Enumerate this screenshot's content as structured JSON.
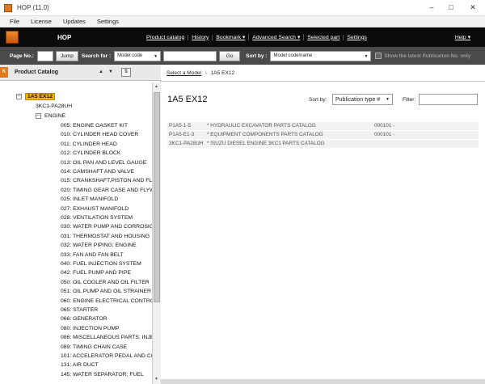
{
  "window": {
    "title": "HOP (11.0)"
  },
  "menubar": [
    "File",
    "License",
    "Updates",
    "Settings"
  ],
  "header": {
    "brand": "HOP",
    "links": [
      "Product catalog",
      "History",
      "Bookmark ▾",
      "Advanced Search ▾",
      "Selected part",
      "Settings"
    ],
    "help": "Help ▾"
  },
  "searchbar": {
    "page_label": "Page No.:",
    "page_value": "",
    "jump_label": "Jump",
    "search_for_label": "Search for :",
    "search_field_value": "Model code",
    "search_text_value": "",
    "go_label": "Go",
    "sort_by_label": "Sort by :",
    "sort_value": "Model code/name",
    "latest_label": "Show the latest Publication No. only"
  },
  "left_panel": {
    "title": "Product Catalog",
    "tab_letter": "K",
    "tree": {
      "root": "1A5 EX12",
      "child": "3KC1-PA28UH",
      "group": "ENGINE",
      "items": [
        "005: ENGINE GASKET KIT",
        "010: CYLINDER HEAD COVER",
        "011: CYLINDER HEAD",
        "012: CYLINDER BLOCK",
        "013: OIL PAN AND LEVEL GAUGE",
        "014: CAMSHAFT AND VALVE",
        "015: CRANKSHAFT,PISTON AND FLY",
        "020: TIMING GEAR CASE AND FLYW",
        "025: INLET MANIFOLD",
        "027: EXHAUST MANIFOLD",
        "028: VENTILATION SYSTEM",
        "030: WATER PUMP AND CORROSIC",
        "031: THERMOSTAT AND HOUSING",
        "032: WATER PIPING; ENGINE",
        "033: FAN AND FAN BELT",
        "040: FUEL INJECTION SYSTEM",
        "042: FUEL PUMP AND PIPE",
        "050: OIL COOLER AND OIL FILTER",
        "051: OIL PUMP AND OIL STRAINER",
        "060: ENGINE ELECTRICAL CONTRO",
        "065: STARTER",
        "066: GENERATOR",
        "080: INJECTION PUMP",
        "086: MISCELLANEOUS PARTS; INJE",
        "089: TIMING CHAIN CASE",
        "101: ACCELERATOR PEDAL AND CC",
        "131: AIR DUCT",
        "145: WATER SEPARATOR; FUEL"
      ]
    }
  },
  "breadcrumb": {
    "link": "Select a Model",
    "sep": "\\",
    "current": "1A5 EX12"
  },
  "main": {
    "model_title": "1A5 EX12",
    "sort_by_label": "Sort by:",
    "sort_value": "Publication type #",
    "filter_label": "Filter:",
    "filter_value": "",
    "results": [
      {
        "code": "P1A5-1-5",
        "title": "* HYDRAULIC EXCAVATOR PARTS CATALOG",
        "serial": "000101 -"
      },
      {
        "code": "P1A5-E1-3",
        "title": "* EQUIPMENT COMPONENTS PARTS CATALOG",
        "serial": "000101 -"
      },
      {
        "code": "3KC1-PA28UH",
        "title": "* ISUZU DIESEL ENGINE 3KC1 PARTS CATALOG",
        "serial": ""
      }
    ]
  },
  "colors": {
    "header_bg": "#0b0b0b",
    "searchbar_bg": "#4a4a4a",
    "selected_model": "#f6b200",
    "brand_orange": "#e07a1f"
  }
}
